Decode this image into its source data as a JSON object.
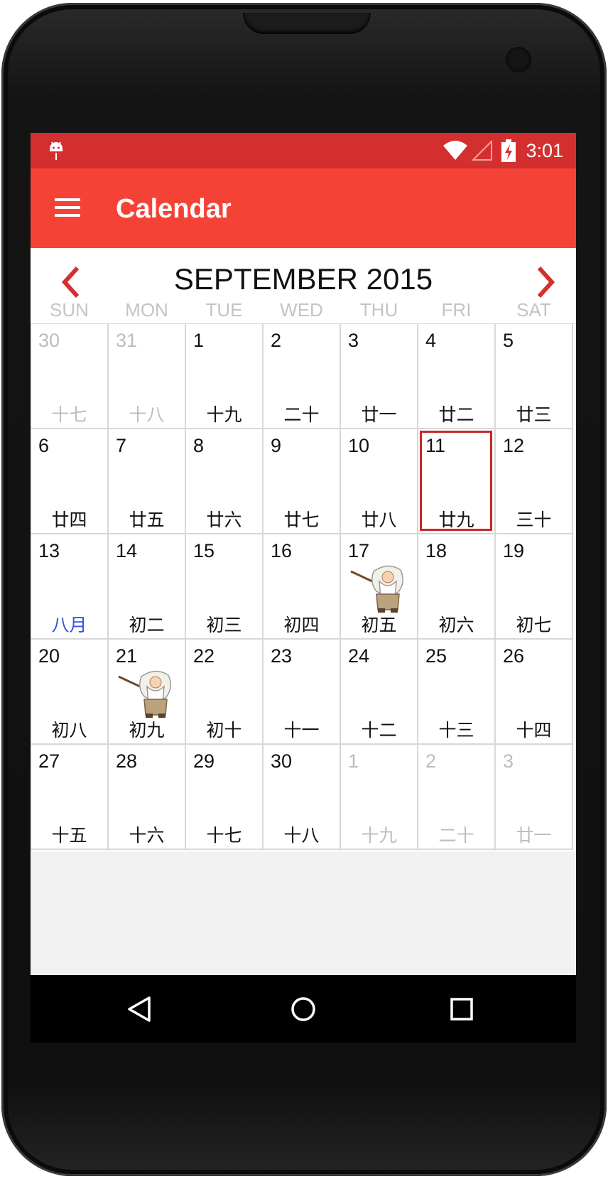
{
  "status_bar": {
    "time": "3:01",
    "icons": [
      "android-debug-icon",
      "wifi-icon",
      "signal-icon",
      "battery-charging-icon"
    ]
  },
  "app_bar": {
    "title": "Calendar",
    "menu_icon": "menu-icon"
  },
  "calendar": {
    "month_title": "SEPTEMBER 2015",
    "weekdays": [
      "SUN",
      "MON",
      "TUE",
      "WED",
      "THU",
      "FRI",
      "SAT"
    ],
    "weeks": [
      [
        {
          "day": "30",
          "lunar": "十七",
          "other_month": true
        },
        {
          "day": "31",
          "lunar": "十八",
          "other_month": true
        },
        {
          "day": "1",
          "lunar": "十九"
        },
        {
          "day": "2",
          "lunar": "二十"
        },
        {
          "day": "3",
          "lunar": "廿一"
        },
        {
          "day": "4",
          "lunar": "廿二"
        },
        {
          "day": "5",
          "lunar": "廿三"
        }
      ],
      [
        {
          "day": "6",
          "lunar": "廿四"
        },
        {
          "day": "7",
          "lunar": "廿五"
        },
        {
          "day": "8",
          "lunar": "廿六"
        },
        {
          "day": "9",
          "lunar": "廿七"
        },
        {
          "day": "10",
          "lunar": "廿八"
        },
        {
          "day": "11",
          "lunar": "廿九",
          "selected": true
        },
        {
          "day": "12",
          "lunar": "三十"
        }
      ],
      [
        {
          "day": "13",
          "lunar": "八月",
          "month_start": true
        },
        {
          "day": "14",
          "lunar": "初二"
        },
        {
          "day": "15",
          "lunar": "初三"
        },
        {
          "day": "16",
          "lunar": "初四"
        },
        {
          "day": "17",
          "lunar": "初五",
          "sticker": true
        },
        {
          "day": "18",
          "lunar": "初六"
        },
        {
          "day": "19",
          "lunar": "初七"
        }
      ],
      [
        {
          "day": "20",
          "lunar": "初八"
        },
        {
          "day": "21",
          "lunar": "初九",
          "sticker": true
        },
        {
          "day": "22",
          "lunar": "初十"
        },
        {
          "day": "23",
          "lunar": "十一"
        },
        {
          "day": "24",
          "lunar": "十二"
        },
        {
          "day": "25",
          "lunar": "十三"
        },
        {
          "day": "26",
          "lunar": "十四"
        }
      ],
      [
        {
          "day": "27",
          "lunar": "十五"
        },
        {
          "day": "28",
          "lunar": "十六"
        },
        {
          "day": "29",
          "lunar": "十七"
        },
        {
          "day": "30",
          "lunar": "十八"
        },
        {
          "day": "1",
          "lunar": "十九",
          "other_month": true
        },
        {
          "day": "2",
          "lunar": "二十",
          "other_month": true
        },
        {
          "day": "3",
          "lunar": "廿一",
          "other_month": true
        }
      ]
    ],
    "colors": {
      "status_bar": "#d32f2f",
      "app_bar": "#f44336",
      "accent": "#c62828",
      "weekday_text": "#c4c4c4",
      "other_month_text": "#bdbdbd",
      "lunar_month_start": "#3a4fe8"
    }
  },
  "nav_bar": {
    "buttons": [
      "back-icon",
      "home-icon",
      "recents-icon"
    ]
  }
}
